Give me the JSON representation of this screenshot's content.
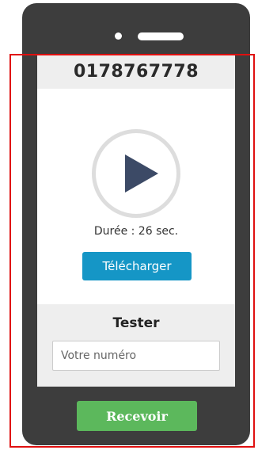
{
  "phone": {
    "number": "0178767778",
    "duration": "Durée : 26 sec.",
    "download_label": "Télécharger"
  },
  "tester": {
    "title": "Tester",
    "input_placeholder": "Votre numéro",
    "input_value": ""
  },
  "receive_label": "Recevoir",
  "icons": {
    "play": "play-icon"
  },
  "colors": {
    "phone_body": "#3d3d3d",
    "download_button": "#1596c6",
    "receive_button": "#5cb85c",
    "highlight_border": "#e01010",
    "play_triangle": "#3c4a66"
  }
}
